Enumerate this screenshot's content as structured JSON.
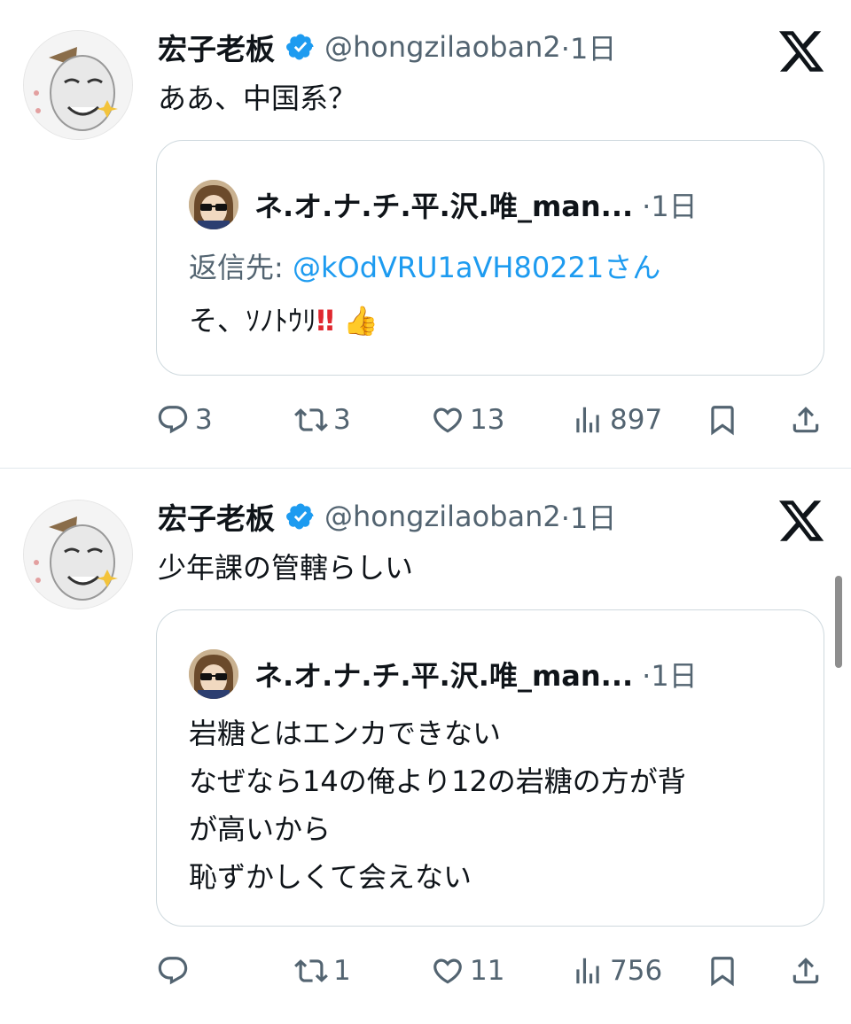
{
  "tweets": [
    {
      "author": {
        "name": "宏子老板",
        "handle": "@hongzilaoban2",
        "meta": "·1日"
      },
      "text": "ああ、中国系？",
      "quote": {
        "author_name": "ネ.オ.ナ.チ.平.沢.唯_man...",
        "meta": "·1日",
        "reply_label": "返信先:",
        "reply_mention": "@kOdVRU1aVH80221さん",
        "lines": [
          "そ、ｿﾉﾄｳﾘ"
        ],
        "emoji": {
          "exclaim": "‼",
          "thumbs": "👍"
        }
      },
      "actions": {
        "replies": "3",
        "reposts": "3",
        "likes": "13",
        "views": "897"
      }
    },
    {
      "author": {
        "name": "宏子老板",
        "handle": "@hongzilaoban2",
        "meta": "·1日"
      },
      "text": "少年課の管轄らしい",
      "quote": {
        "author_name": "ネ.オ.ナ.チ.平.沢.唯_man...",
        "meta": "·1日",
        "lines": [
          "岩糖とはエンカできない",
          "なぜなら14の俺より12の岩糖の方が背",
          "が高いから",
          "恥ずかしくて会えない"
        ]
      },
      "actions": {
        "replies": "",
        "reposts": "1",
        "likes": "11",
        "views": "756"
      }
    }
  ],
  "icons": [
    "verified-badge-icon",
    "x-logo-icon",
    "reply-icon",
    "repost-icon",
    "like-icon",
    "views-icon",
    "bookmark-icon",
    "share-icon"
  ],
  "colors": {
    "link": "#1d9bf0",
    "secondary": "#536471",
    "border": "#cfd9de",
    "text": "#0f1419"
  }
}
